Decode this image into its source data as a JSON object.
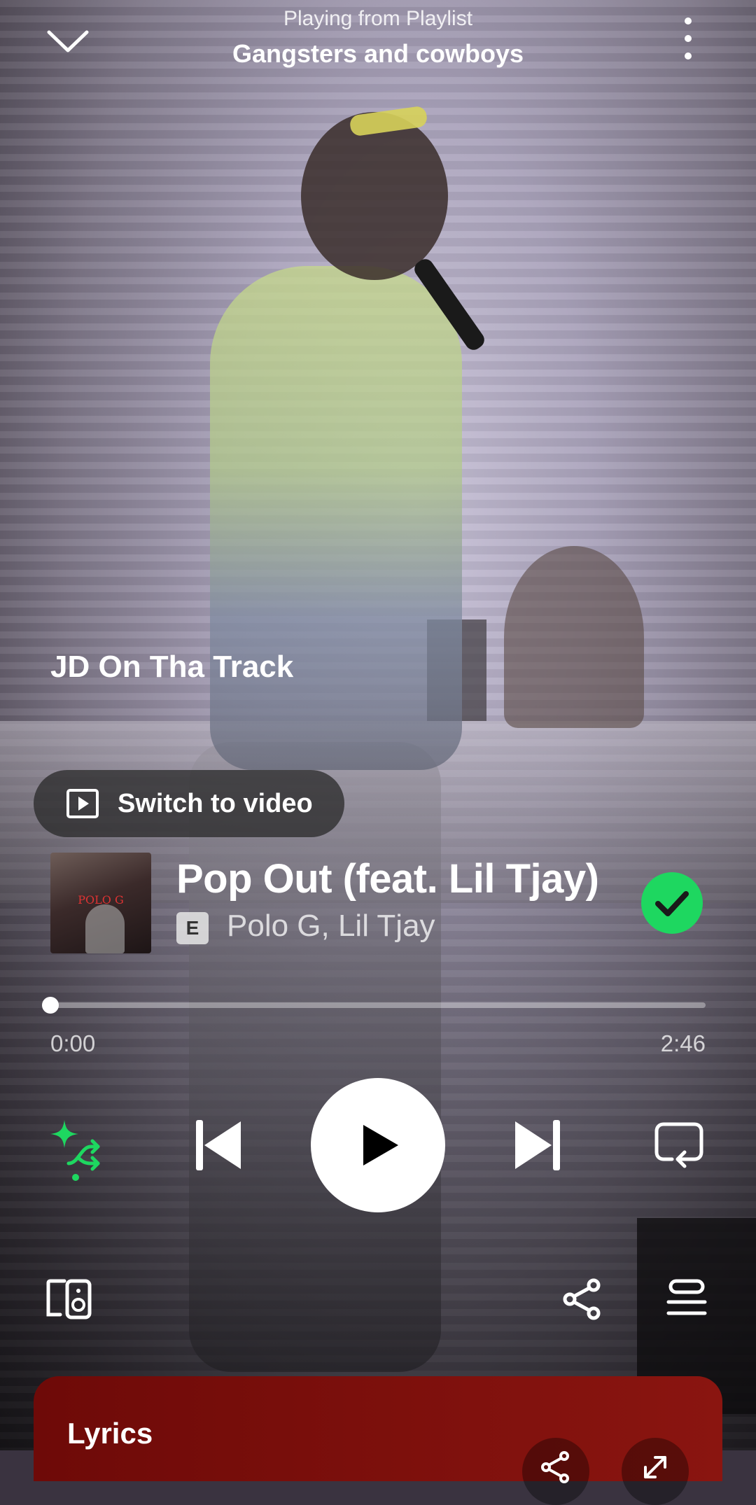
{
  "header": {
    "context_label": "Playing from Playlist",
    "playlist_name": "Gangsters and cowboys"
  },
  "canvas": {
    "artist_caption": "JD On Tha Track",
    "switch_video_label": "Switch to video"
  },
  "track": {
    "title": "Pop Out (feat. Lil Tjay)",
    "explicit_badge": "E",
    "artists": "Polo G, Lil Tjay",
    "liked": true,
    "album_art_text": "POLO G"
  },
  "progress": {
    "elapsed": "0:00",
    "total": "2:46",
    "fraction": 0.0
  },
  "controls": {
    "shuffle_mode": "smart-shuffle",
    "play_state": "paused",
    "repeat_mode": "off"
  },
  "lyrics": {
    "label": "Lyrics"
  },
  "colors": {
    "accent_green": "#1ed760",
    "lyrics_card": "#7d100c"
  },
  "icons": {
    "collapse": "chevron-down-icon",
    "more": "more-vertical-icon",
    "video": "video-play-icon",
    "liked": "check-circle-icon",
    "shuffle": "smart-shuffle-icon",
    "previous": "skip-previous-icon",
    "play": "play-icon",
    "next": "skip-next-icon",
    "repeat": "repeat-icon",
    "devices": "connect-devices-icon",
    "share": "share-icon",
    "queue": "queue-icon",
    "expand": "expand-icon"
  }
}
